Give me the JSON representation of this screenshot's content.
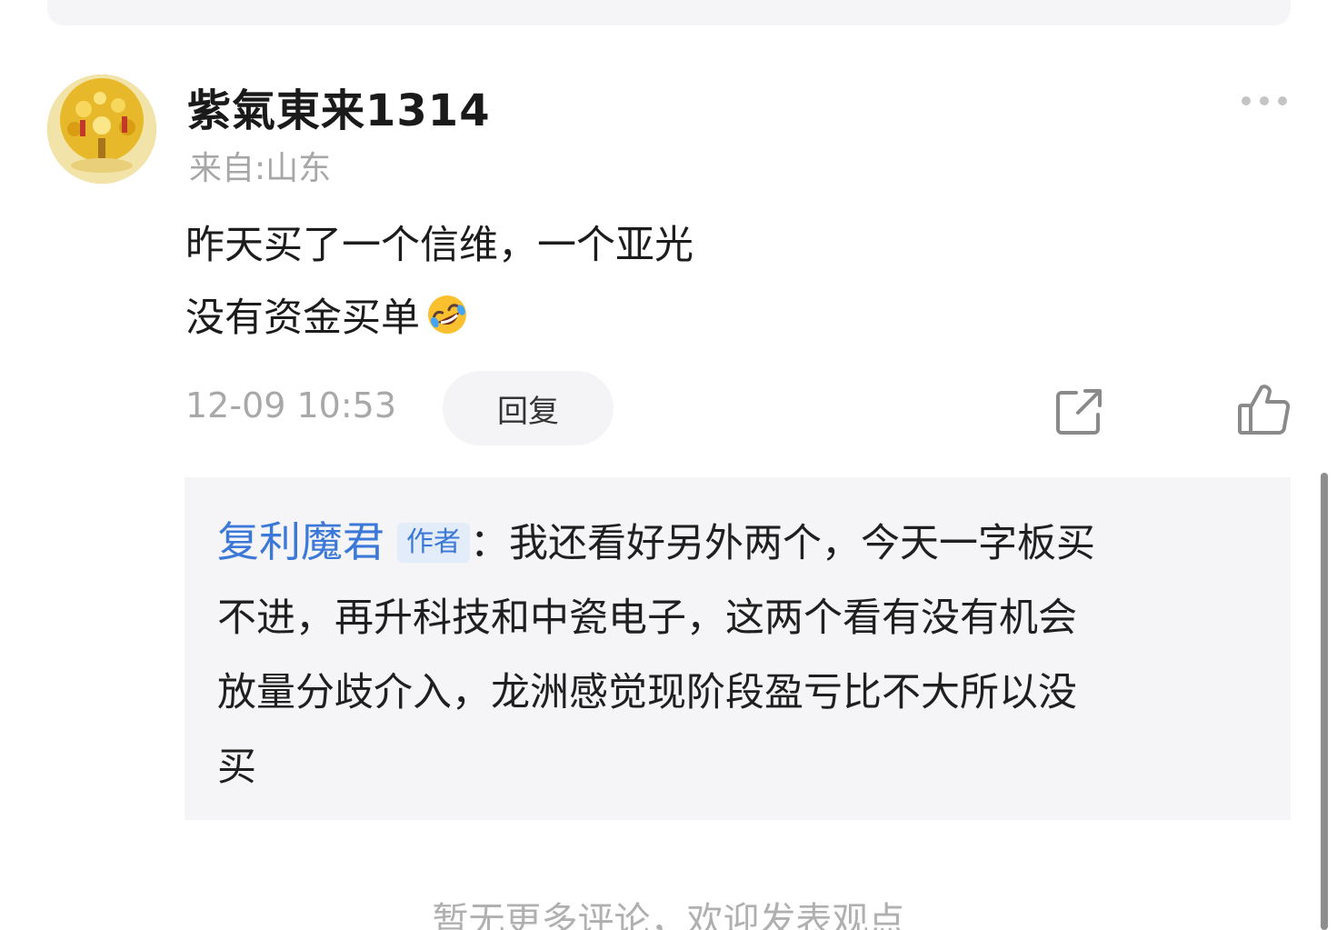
{
  "comment": {
    "username": "紫氣東来1314",
    "location": "来自:山东",
    "text_lines": [
      "昨天买了一个信维，一个亚光",
      "没有资金买单"
    ],
    "emoji": "rolling-on-floor-laughing-emoji",
    "timestamp": "12-09 10:53",
    "reply_label": "回复",
    "more_icon": "more-dots-icon",
    "share_icon": "share-icon",
    "like_icon": "thumbs-up-icon"
  },
  "reply": {
    "author": "复利魔君",
    "badge": "作者",
    "separator": "：",
    "lines": [
      "我还看好另外两个，今天一字板买",
      "不进，再升科技和中瓷电子，这两个看有没有机会",
      "放量分歧介入，龙洲感觉现阶段盈亏比不大所以没",
      "买"
    ]
  },
  "footer": {
    "note": "暂无更多评论，欢迎发表观点"
  },
  "colors": {
    "accent_blue": "#3b78d8",
    "muted_gray": "#a7a7a7",
    "panel_bg": "#f5f5f7"
  }
}
